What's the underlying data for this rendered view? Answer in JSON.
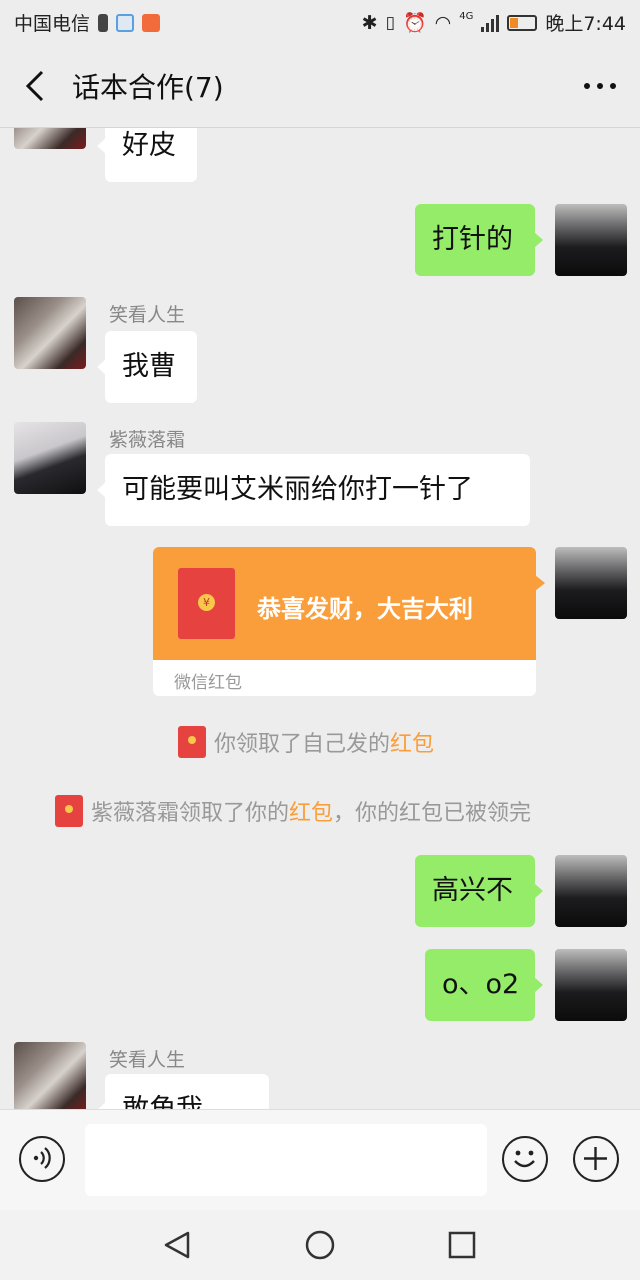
{
  "status_bar": {
    "carrier": "中国电信",
    "time": "晚上7:44",
    "network": "4G"
  },
  "header": {
    "title": "话本合作(7)"
  },
  "messages": [
    {
      "sender": "",
      "text": "好皮",
      "side": "in",
      "avatar": "rose-avatar"
    },
    {
      "sender": "",
      "text": "打针的",
      "side": "out",
      "avatar": "cap-girl-avatar"
    },
    {
      "sender": "笑看人生",
      "text": "我曹",
      "side": "in",
      "avatar": "rose-avatar"
    },
    {
      "sender": "紫薇落霜",
      "text": "可能要叫艾米丽给你打一针了",
      "side": "in",
      "avatar": "girl-avatar"
    },
    {
      "sender": "",
      "text": "恭喜发财，大吉大利",
      "side": "out",
      "type": "red-packet",
      "label": "微信红包",
      "avatar": "cap-girl-avatar"
    },
    {
      "sender": "",
      "text": "高兴不",
      "side": "out",
      "avatar": "cap-girl-avatar"
    },
    {
      "sender": "",
      "text": "o、o2",
      "side": "out",
      "avatar": "cap-girl-avatar"
    },
    {
      "sender": "笑看人生",
      "text": "敢角我",
      "side": "in",
      "avatar": "rose-avatar"
    }
  ],
  "system_notices": [
    {
      "prefix": "你领取了自己发的",
      "link": "红包",
      "suffix": ""
    },
    {
      "prefix": "紫薇落霜领取了你的",
      "link": "红包",
      "suffix": "，你的红包已被领完"
    }
  ],
  "input": {
    "placeholder": ""
  },
  "colors": {
    "background": "#ededed",
    "outgoing_bubble": "#95ec69",
    "incoming_bubble": "#ffffff",
    "red_packet": "#fa9e3b",
    "highlight": "#fa9e3b"
  }
}
